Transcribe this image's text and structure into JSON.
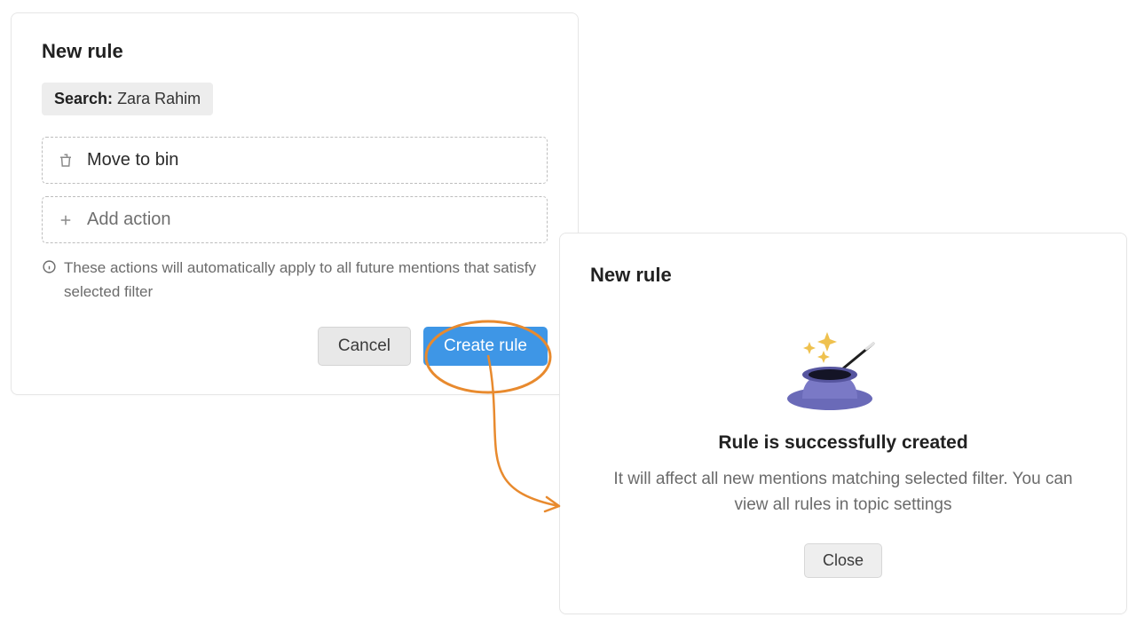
{
  "left": {
    "title": "New rule",
    "filter_label": "Search:",
    "filter_value": "Zara Rahim",
    "action_move_to_bin": "Move to bin",
    "add_action": "Add action",
    "info_text": "These actions will automatically apply to all future mentions that satisfy selected filter",
    "cancel": "Cancel",
    "create": "Create rule"
  },
  "right": {
    "title": "New rule",
    "success_title": "Rule is successfully created",
    "success_body": "It will affect all new mentions matching selected filter. You can view all rules in topic settings",
    "close": "Close"
  }
}
